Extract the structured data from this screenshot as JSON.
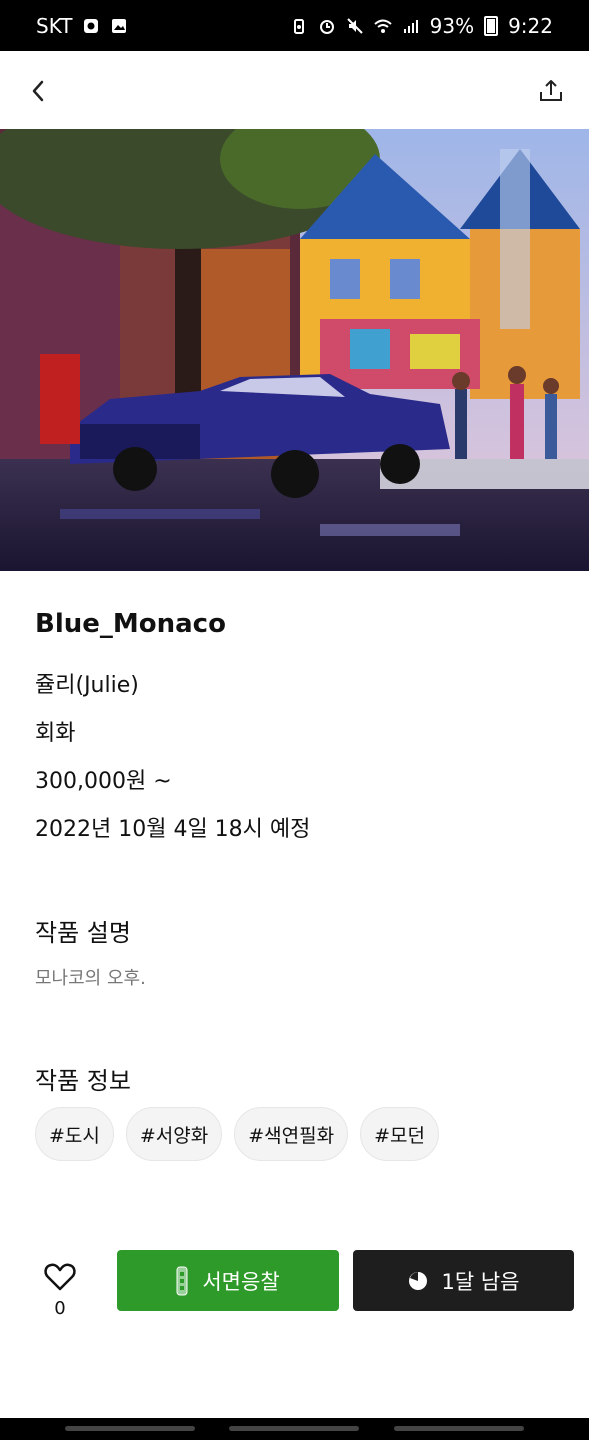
{
  "status_bar": {
    "carrier": "SKT",
    "battery": "93%",
    "time": "9:22"
  },
  "artwork": {
    "title": "Blue_Monaco",
    "artist": "쥴리(Julie)",
    "category": "회화",
    "price": "300,000원 ~",
    "schedule": "2022년 10월 4일 18시 예정"
  },
  "description": {
    "heading": "작품 설명",
    "text": "모나코의 오후."
  },
  "info": {
    "heading": "작품 정보",
    "tags": [
      "#도시",
      "#서양화",
      "#색연필화",
      "#모던"
    ]
  },
  "actions": {
    "like_count": "0",
    "bid_label": "서면응찰",
    "time_left": "1달 남음"
  },
  "colors": {
    "bid_green": "#2e9a2a",
    "dark": "#1e1e1e"
  }
}
